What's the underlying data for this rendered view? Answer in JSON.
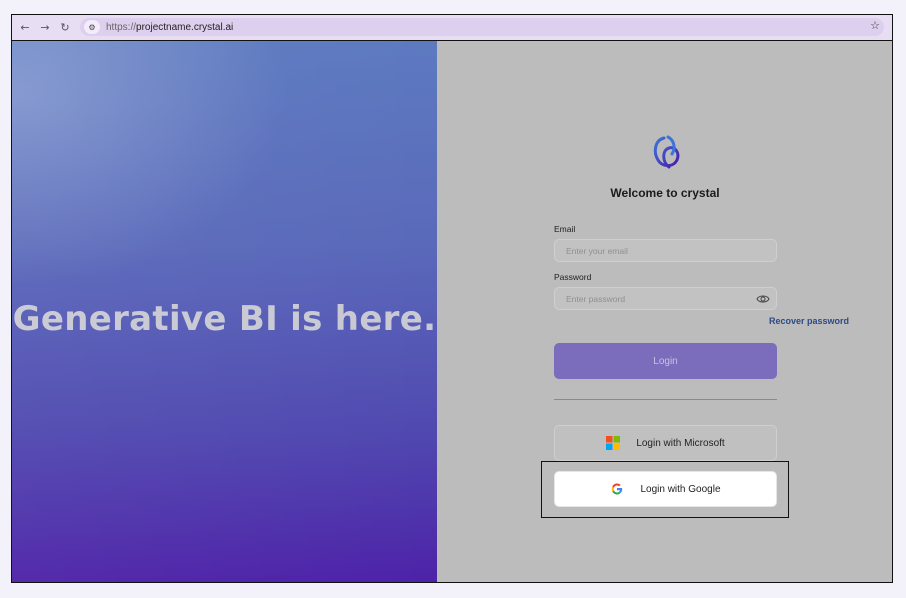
{
  "browser": {
    "url_scheme": "https://",
    "url_host": "projectname.crystal.ai",
    "back_icon": "arrow-left-icon",
    "forward_icon": "arrow-right-icon",
    "reload_icon": "reload-icon",
    "site_info_icon": "site-settings-icon",
    "bookmark_icon": "star-icon"
  },
  "hero": {
    "headline": "Generative BI is here."
  },
  "login": {
    "welcome": "Welcome to crystal",
    "email_label": "Email",
    "email_placeholder": "Enter your email",
    "password_label": "Password",
    "password_placeholder": "Enter password",
    "recover_link": "Recover password",
    "login_button": "Login",
    "microsoft_button": "Login with Microsoft",
    "google_button": "Login with Google"
  },
  "colors": {
    "hero_top": "#5d7ac0",
    "hero_bottom": "#4d22a8",
    "panel_bg": "#bcbcbc",
    "login_button_bg": "#7b6dbb",
    "recover_link": "#2b4a86"
  }
}
